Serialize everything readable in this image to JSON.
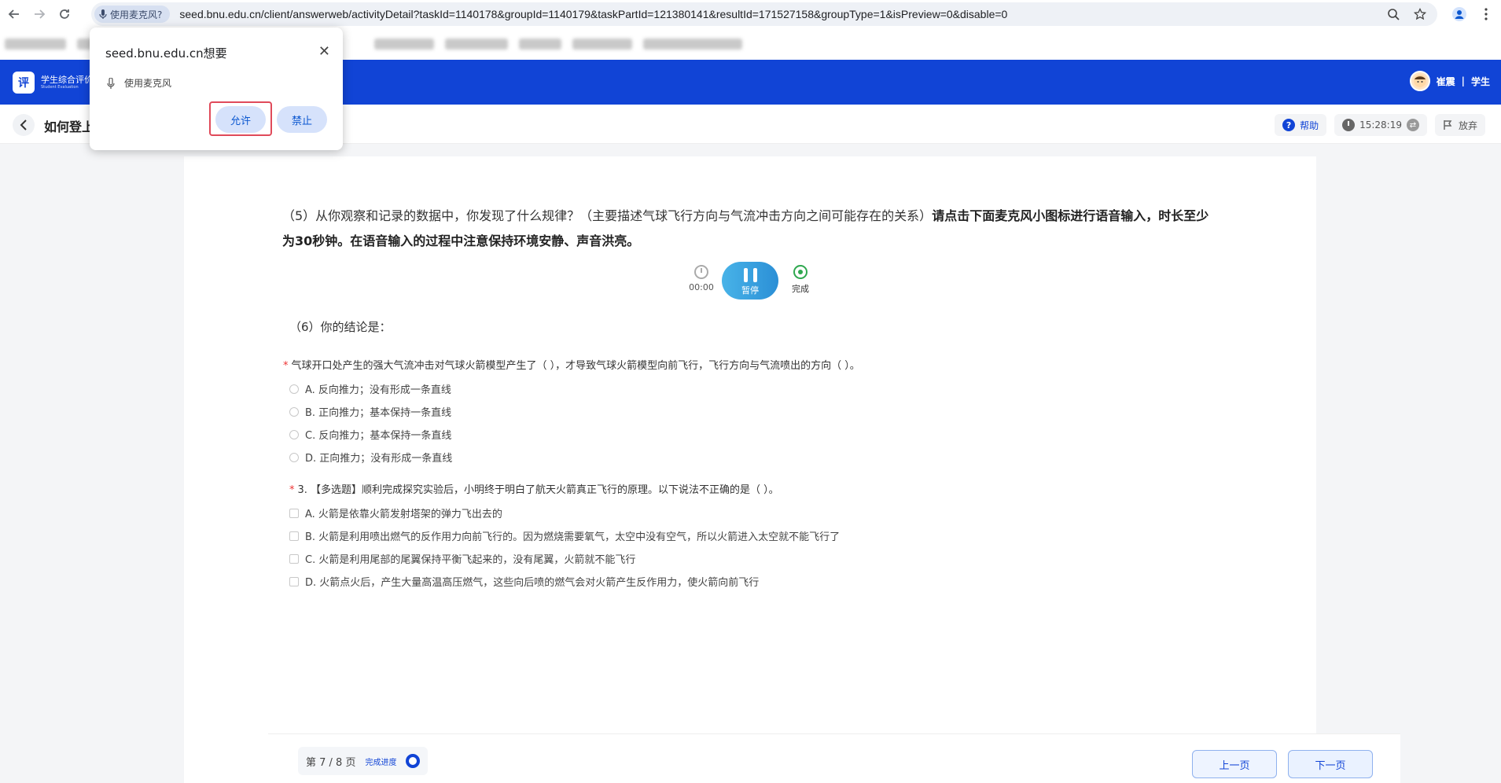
{
  "browser": {
    "mic_chip_label": "使用麦克风?",
    "url": "seed.bnu.edu.cn/client/answerweb/activityDetail?taskId=1140178&groupId=1140179&taskPartId=121380141&resultId=171527158&groupType=1&isPreview=0&disable=0"
  },
  "permission_popup": {
    "title": "seed.bnu.edu.cn想要",
    "request": "使用麦克风",
    "allow_label": "允许",
    "deny_label": "禁止",
    "close_glyph": "✕"
  },
  "app_header": {
    "logo_glyph": "评",
    "logo_line1": "学生综合评价",
    "logo_line2": "Student Evaluation",
    "user_name": "崔震",
    "separator": "|",
    "user_role": "学生"
  },
  "sub_header": {
    "back_glyph": "‹",
    "title": "如何登上",
    "help_label": "帮助",
    "timer": "15:28:19",
    "abandon_label": "放弃"
  },
  "question5": {
    "normal": "（5）从你观察和记录的数据中，你发现了什么规律？（主要描述气球飞行方向与气流冲击方向之间可能存在的关系）",
    "bold": "请点击下面麦克风小图标进行语音输入，时长至少为30秒钟。在语音输入的过程中注意保持环境安静、声音洪亮。"
  },
  "recorder": {
    "time": "00:00",
    "pause_label": "暂停",
    "done_label": "完成"
  },
  "question6": {
    "label": "（6）你的结论是："
  },
  "q_single": {
    "required_mark": "*",
    "stem": "气球开口处产生的强大气流冲击对气球火箭模型产生了（ ），才导致气球火箭模型向前飞行，飞行方向与气流喷出的方向（ ）。",
    "options": [
      "A. 反向推力；没有形成一条直线",
      "B. 正向推力；基本保持一条直线",
      "C. 反向推力；基本保持一条直线",
      "D. 正向推力；没有形成一条直线"
    ]
  },
  "q_multi": {
    "required_mark": "*",
    "stem": "3. 【多选题】顺利完成探究实验后，小明终于明白了航天火箭真正飞行的原理。以下说法不正确的是（ ）。",
    "options": [
      "A. 火箭是依靠火箭发射塔架的弹力飞出去的",
      "B. 火箭是利用喷出燃气的反作用力向前飞行的。因为燃烧需要氧气，太空中没有空气，所以火箭进入太空就不能飞行了",
      "C. 火箭是利用尾部的尾翼保持平衡飞起来的，没有尾翼，火箭就不能飞行",
      "D. 火箭点火后，产生大量高温高压燃气，这些向后喷的燃气会对火箭产生反作用力，使火箭向前飞行"
    ]
  },
  "footer": {
    "page_info": "第 7 / 8 页",
    "progress_label": "完成进度",
    "prev_label": "上一页",
    "next_label": "下一页"
  },
  "colors": {
    "brand_blue": "#1144d6",
    "required_red": "#e33333",
    "highlight_red": "#e04a5a"
  }
}
